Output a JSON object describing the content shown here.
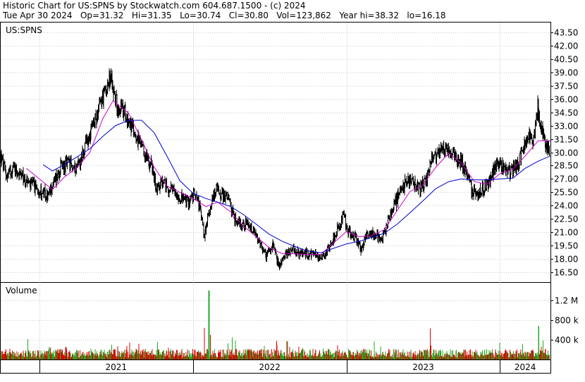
{
  "header": {
    "line1": "Historic Chart for US:SPNS by Stockwatch.com 604.687.1500 - (c) 2024",
    "line2": "Tue Apr 30 2024   Op=31.32   Hi=31.35   Lo=30.74   Cl=30.80   Vol=123,862   Year hi=38.32   lo=16.18"
  },
  "colors": {
    "price": "#000000",
    "ma_fast": "#cc00cc",
    "ma_slow": "#0000cc",
    "vol_up": "#22aa22",
    "vol_down": "#dd0000",
    "grid": "#999999",
    "frame": "#000000"
  },
  "chart_data": [
    {
      "type": "line",
      "label": "US:SPNS",
      "y_ticks": [
        "43.50",
        "42.00",
        "40.50",
        "39.00",
        "37.50",
        "36.00",
        "34.50",
        "33.00",
        "31.50",
        "30.00",
        "28.50",
        "27.00",
        "25.50",
        "24.00",
        "22.50",
        "21.00",
        "19.50",
        "18.00",
        "16.50"
      ],
      "ylim": [
        15.4,
        44.6
      ],
      "x_ticks": [
        "2021",
        "2022",
        "2023",
        "2024"
      ],
      "x_range": [
        "2020-10-01",
        "2024-04-30"
      ],
      "x_boundaries": [
        "2021-01-01",
        "2022-01-01",
        "2023-01-01",
        "2024-01-01"
      ],
      "series": [
        {
          "name": "",
          "role": "price",
          "points": [
            [
              "2020-10-01",
              29.5
            ],
            [
              "2020-10-15",
              27.3
            ],
            [
              "2020-11-01",
              28.4
            ],
            [
              "2020-11-20",
              27.2
            ],
            [
              "2020-12-10",
              26.4
            ],
            [
              "2021-01-01",
              25.8
            ],
            [
              "2021-01-20",
              24.9
            ],
            [
              "2021-02-05",
              26.7
            ],
            [
              "2021-02-20",
              28.3
            ],
            [
              "2021-03-10",
              28.7
            ],
            [
              "2021-03-25",
              28.2
            ],
            [
              "2021-04-10",
              29.2
            ],
            [
              "2021-04-25",
              31.3
            ],
            [
              "2021-05-10",
              33.0
            ],
            [
              "2021-05-25",
              35.3
            ],
            [
              "2021-06-10",
              37.4
            ],
            [
              "2021-06-20",
              38.2
            ],
            [
              "2021-07-05",
              35.3
            ],
            [
              "2021-07-25",
              34.5
            ],
            [
              "2021-08-10",
              32.6
            ],
            [
              "2021-08-25",
              31.2
            ],
            [
              "2021-09-10",
              29.5
            ],
            [
              "2021-09-25",
              28.6
            ],
            [
              "2021-10-05",
              26.0
            ],
            [
              "2021-10-20",
              26.5
            ],
            [
              "2021-11-10",
              25.7
            ],
            [
              "2021-12-01",
              25.0
            ],
            [
              "2021-12-20",
              24.4
            ],
            [
              "2022-01-10",
              25.6
            ],
            [
              "2022-01-20",
              23.0
            ],
            [
              "2022-01-28",
              20.6
            ],
            [
              "2022-02-10",
              23.8
            ],
            [
              "2022-02-25",
              25.9
            ],
            [
              "2022-03-10",
              25.3
            ],
            [
              "2022-03-25",
              24.9
            ],
            [
              "2022-04-10",
              22.5
            ],
            [
              "2022-04-25",
              22.0
            ],
            [
              "2022-05-10",
              21.8
            ],
            [
              "2022-05-25",
              21.0
            ],
            [
              "2022-06-10",
              19.6
            ],
            [
              "2022-06-25",
              18.3
            ],
            [
              "2022-07-10",
              19.5
            ],
            [
              "2022-07-25",
              17.2
            ],
            [
              "2022-08-10",
              18.5
            ],
            [
              "2022-08-25",
              19.3
            ],
            [
              "2022-09-10",
              18.5
            ],
            [
              "2022-09-25",
              18.7
            ],
            [
              "2022-10-10",
              18.6
            ],
            [
              "2022-10-25",
              18.3
            ],
            [
              "2022-11-10",
              18.4
            ],
            [
              "2022-11-25",
              19.8
            ],
            [
              "2022-12-10",
              21.3
            ],
            [
              "2022-12-25",
              22.8
            ],
            [
              "2023-01-05",
              21.0
            ],
            [
              "2023-01-20",
              20.6
            ],
            [
              "2023-02-05",
              19.0
            ],
            [
              "2023-02-20",
              21.0
            ],
            [
              "2023-03-10",
              20.9
            ],
            [
              "2023-03-25",
              20.0
            ],
            [
              "2023-04-10",
              22.4
            ],
            [
              "2023-04-25",
              24.3
            ],
            [
              "2023-05-10",
              25.5
            ],
            [
              "2023-05-25",
              27.0
            ],
            [
              "2023-06-10",
              26.4
            ],
            [
              "2023-06-25",
              25.9
            ],
            [
              "2023-07-10",
              26.8
            ],
            [
              "2023-07-25",
              29.7
            ],
            [
              "2023-08-10",
              30.2
            ],
            [
              "2023-08-25",
              30.5
            ],
            [
              "2023-09-10",
              29.7
            ],
            [
              "2023-09-25",
              29.3
            ],
            [
              "2023-10-10",
              28.0
            ],
            [
              "2023-10-25",
              25.9
            ],
            [
              "2023-11-10",
              25.4
            ],
            [
              "2023-11-25",
              25.9
            ],
            [
              "2023-12-10",
              26.9
            ],
            [
              "2023-12-25",
              29.0
            ],
            [
              "2024-01-10",
              28.3
            ],
            [
              "2024-01-25",
              27.8
            ],
            [
              "2024-02-10",
              28.5
            ],
            [
              "2024-02-25",
              30.5
            ],
            [
              "2024-03-10",
              31.6
            ],
            [
              "2024-03-20",
              30.9
            ],
            [
              "2024-03-30",
              35.1
            ],
            [
              "2024-04-10",
              32.3
            ],
            [
              "2024-04-20",
              30.3
            ],
            [
              "2024-04-30",
              30.8
            ]
          ]
        },
        {
          "name": "",
          "role": "ma_fast",
          "points": [
            [
              "2020-12-01",
              28.2
            ],
            [
              "2021-01-01",
              27.0
            ],
            [
              "2021-02-01",
              25.8
            ],
            [
              "2021-03-01",
              27.2
            ],
            [
              "2021-04-01",
              28.3
            ],
            [
              "2021-05-01",
              30.0
            ],
            [
              "2021-06-01",
              33.8
            ],
            [
              "2021-06-25",
              35.8
            ],
            [
              "2021-08-01",
              34.4
            ],
            [
              "2021-09-01",
              31.4
            ],
            [
              "2021-10-01",
              28.3
            ],
            [
              "2021-11-01",
              26.2
            ],
            [
              "2021-12-01",
              25.5
            ],
            [
              "2022-01-01",
              24.8
            ],
            [
              "2022-02-01",
              23.9
            ],
            [
              "2022-03-01",
              24.4
            ],
            [
              "2022-04-01",
              23.3
            ],
            [
              "2022-05-01",
              21.7
            ],
            [
              "2022-06-01",
              20.5
            ],
            [
              "2022-07-01",
              19.3
            ],
            [
              "2022-08-01",
              18.6
            ],
            [
              "2022-09-01",
              18.6
            ],
            [
              "2022-10-01",
              18.5
            ],
            [
              "2022-11-01",
              18.5
            ],
            [
              "2022-12-01",
              19.8
            ],
            [
              "2023-01-01",
              21.1
            ],
            [
              "2023-02-01",
              20.5
            ],
            [
              "2023-03-01",
              20.6
            ],
            [
              "2023-04-01",
              21.3
            ],
            [
              "2023-05-01",
              23.4
            ],
            [
              "2023-06-01",
              25.6
            ],
            [
              "2023-07-01",
              26.3
            ],
            [
              "2023-08-01",
              28.3
            ],
            [
              "2023-09-01",
              29.9
            ],
            [
              "2023-10-01",
              28.8
            ],
            [
              "2023-11-01",
              26.7
            ],
            [
              "2023-12-01",
              26.4
            ],
            [
              "2024-01-01",
              27.6
            ],
            [
              "2024-02-01",
              28.1
            ],
            [
              "2024-03-01",
              29.6
            ],
            [
              "2024-04-01",
              31.3
            ],
            [
              "2024-04-30",
              31.3
            ]
          ]
        },
        {
          "name": "",
          "role": "ma_slow",
          "points": [
            [
              "2021-01-10",
              28.6
            ],
            [
              "2021-02-01",
              27.9
            ],
            [
              "2021-03-01",
              28.6
            ],
            [
              "2021-04-01",
              29.5
            ],
            [
              "2021-05-01",
              30.4
            ],
            [
              "2021-06-01",
              31.8
            ],
            [
              "2021-07-01",
              33.0
            ],
            [
              "2021-08-01",
              33.6
            ],
            [
              "2021-09-01",
              33.6
            ],
            [
              "2021-10-01",
              32.2
            ],
            [
              "2021-11-01",
              29.5
            ],
            [
              "2021-12-01",
              26.8
            ],
            [
              "2022-01-01",
              25.4
            ],
            [
              "2022-02-01",
              24.8
            ],
            [
              "2022-03-01",
              24.4
            ],
            [
              "2022-04-01",
              23.9
            ],
            [
              "2022-05-01",
              23.0
            ],
            [
              "2022-06-01",
              21.9
            ],
            [
              "2022-07-01",
              20.8
            ],
            [
              "2022-08-01",
              20.0
            ],
            [
              "2022-09-01",
              19.4
            ],
            [
              "2022-10-01",
              18.9
            ],
            [
              "2022-11-01",
              18.7
            ],
            [
              "2022-12-01",
              19.2
            ],
            [
              "2023-01-01",
              19.7
            ],
            [
              "2023-02-01",
              20.0
            ],
            [
              "2023-03-01",
              20.4
            ],
            [
              "2023-04-01",
              20.9
            ],
            [
              "2023-05-01",
              21.9
            ],
            [
              "2023-06-01",
              23.2
            ],
            [
              "2023-07-01",
              24.5
            ],
            [
              "2023-08-01",
              25.9
            ],
            [
              "2023-09-01",
              26.7
            ],
            [
              "2023-10-01",
              27.0
            ],
            [
              "2023-11-01",
              26.9
            ],
            [
              "2023-12-01",
              26.9
            ],
            [
              "2024-01-01",
              27.0
            ],
            [
              "2024-02-01",
              27.1
            ],
            [
              "2024-03-01",
              28.2
            ],
            [
              "2024-04-01",
              29.0
            ],
            [
              "2024-04-30",
              29.6
            ]
          ]
        }
      ]
    },
    {
      "type": "bar",
      "label": "Volume",
      "y_ticks": [
        "1.2 M",
        "800 k",
        "400 k"
      ],
      "ylim": [
        0,
        1500000
      ],
      "x_ticks": [
        "2021",
        "2022",
        "2023",
        "2024"
      ],
      "spikes": [
        {
          "date": "2020-12-05",
          "value": 410000,
          "up": true
        },
        {
          "date": "2021-03-05",
          "value": 250000,
          "up": false
        },
        {
          "date": "2021-06-22",
          "value": 300000,
          "up": true
        },
        {
          "date": "2022-01-28",
          "value": 640000,
          "up": false
        },
        {
          "date": "2022-02-08",
          "value": 1400000,
          "up": true
        },
        {
          "date": "2022-02-12",
          "value": 500000,
          "up": false
        },
        {
          "date": "2022-04-05",
          "value": 450000,
          "up": true
        },
        {
          "date": "2022-07-20",
          "value": 300000,
          "up": false
        },
        {
          "date": "2023-07-20",
          "value": 630000,
          "up": false
        },
        {
          "date": "2024-04-02",
          "value": 680000,
          "up": true
        },
        {
          "date": "2024-04-08",
          "value": 260000,
          "up": false
        }
      ],
      "base_level": 160000
    }
  ]
}
